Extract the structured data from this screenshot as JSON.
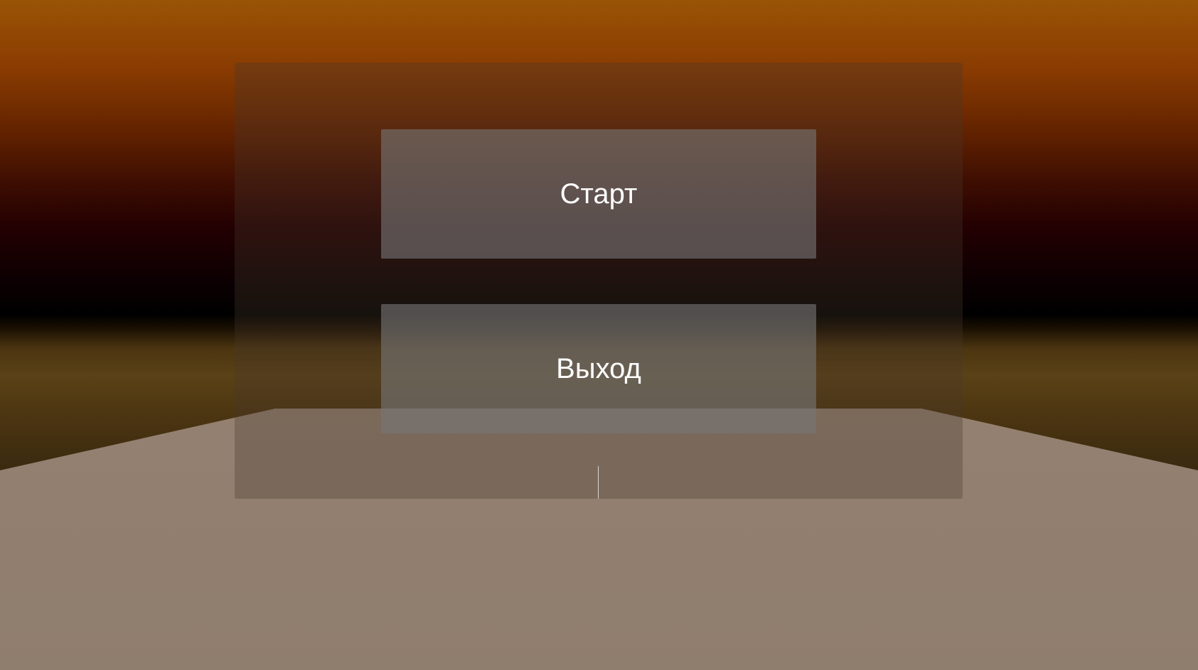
{
  "menu": {
    "start_label": "Старт",
    "exit_label": "Выход"
  },
  "colors": {
    "sky_top": "#9a5405",
    "horizon": "#000000",
    "ground_band": "#5a4116",
    "floor": "#9c8573",
    "button_fill": "#767676",
    "button_text": "#ffffff"
  }
}
